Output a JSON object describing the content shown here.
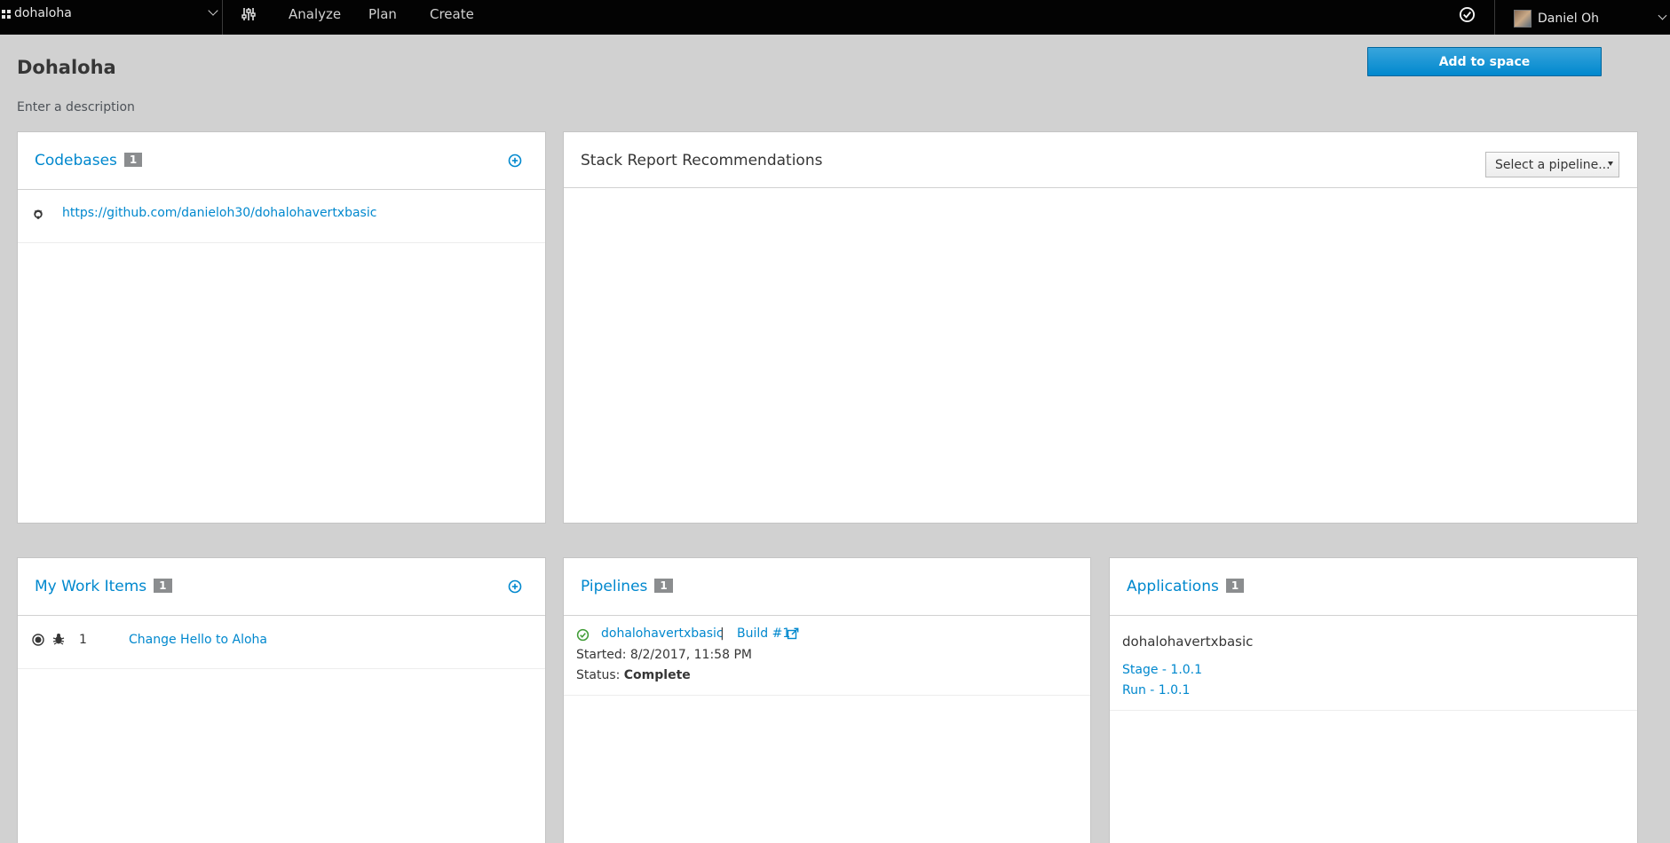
{
  "topbar": {
    "space_name": "dohaloha",
    "nav": [
      "Analyze",
      "Plan",
      "Create"
    ],
    "user_name": "Daniel Oh"
  },
  "header": {
    "title": "Dohaloha",
    "description": "Enter a description",
    "add_button": "Add to space"
  },
  "codebases": {
    "title": "Codebases",
    "count": "1",
    "items": [
      {
        "url": "https://github.com/danieloh30/dohalohavertxbasic",
        "icon": "github-icon"
      }
    ]
  },
  "stack_report": {
    "title": "Stack Report Recommendations",
    "select_value": "Select a pipeline..."
  },
  "work_items": {
    "title": "My Work Items",
    "count": "1",
    "items": [
      {
        "number": "1",
        "title": "Change Hello to Aloha",
        "icons": [
          "state-icon",
          "bug-icon"
        ]
      }
    ]
  },
  "pipelines": {
    "title": "Pipelines",
    "count": "1",
    "items": [
      {
        "name": "dohalohavertxbasic",
        "separator": "|",
        "build": "Build #1",
        "started": "Started: 8/2/2017, 11:58 PM",
        "status_label": "Status:",
        "status_value": "Complete"
      }
    ]
  },
  "applications": {
    "title": "Applications",
    "count": "1",
    "items": [
      {
        "name": "dohalohavertxbasic",
        "stage": "Stage - 1.0.1",
        "run": "Run - 1.0.1"
      }
    ]
  },
  "colors": {
    "topbar_bg": "#030303",
    "page_bg": "#d1d1d1",
    "link": "#0088ce",
    "primary_button": "#0088ce",
    "success": "#3f9c35"
  }
}
